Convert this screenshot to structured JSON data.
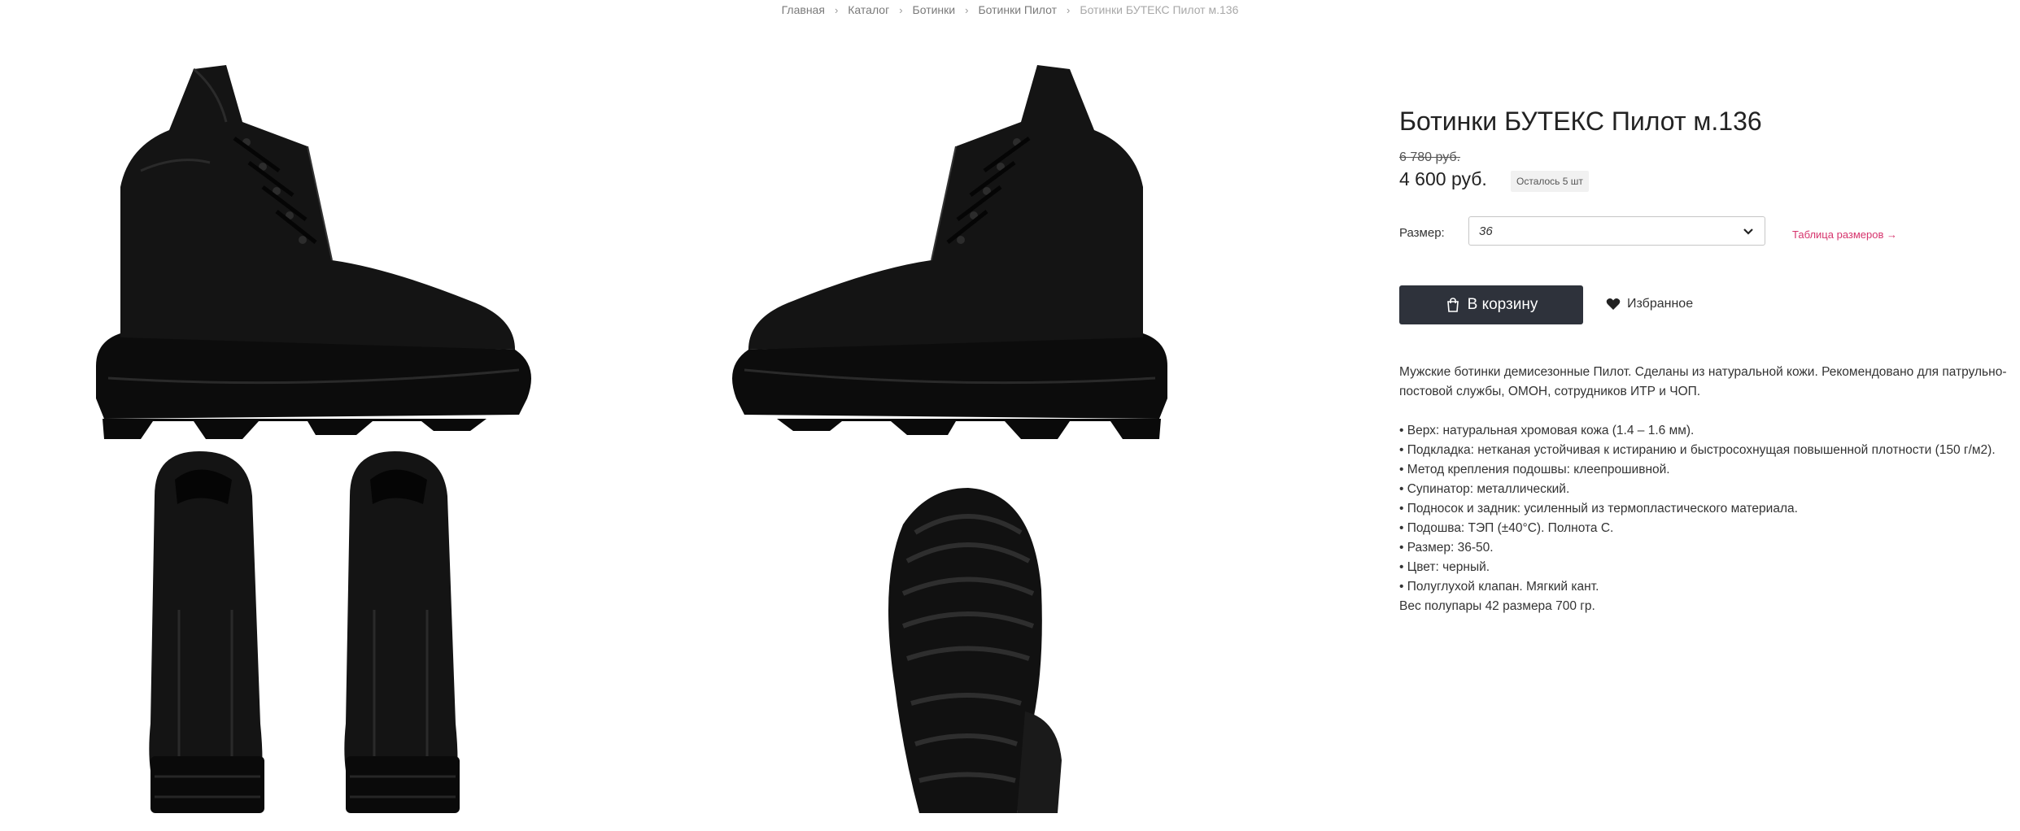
{
  "breadcrumb": {
    "items": [
      "Главная",
      "Каталог",
      "Ботинки",
      "Ботинки Пилот"
    ],
    "current": "Ботинки БУТЕКС Пилот м.136",
    "separator": "›"
  },
  "product": {
    "title": "Ботинки БУТЕКС Пилот м.136",
    "old_price": "6 780 руб.",
    "price": "4 600 руб.",
    "stock_badge": "Осталось 5 шт",
    "size_label": "Размер:",
    "size_value": "36",
    "size_table_link": "Таблица размеров →",
    "cart_button": "В корзину",
    "favorite_label": "Избранное",
    "description_intro": "Мужские ботинки демисезонные Пилот. Сделаны из натуральной кожи. Рекомендовано для патрульно-постовой службы, ОМОН, сотрудников ИТР и ЧОП.",
    "features": [
      "• Верх: натуральная хромовая кожа (1.4 – 1.6 мм).",
      "• Подкладка: нетканая устойчивая к истиранию и быстросохнущая повышенной плотности (150 г/м2).",
      "• Метод крепления подошвы: клеепрошивной.",
      "• Супинатор: металлический.",
      "• Подносок и задник: усиленный из термопластического материала.",
      "• Подошва: ТЭП (±40°С). Полнота С.",
      "• Размер: 36-50.",
      "• Цвет: черный.",
      "• Полуглухой клапан. Мягкий кант."
    ],
    "weight_note": "Вес полупары 42 размера 700 гр."
  },
  "colors": {
    "button_bg": "#2e323b",
    "link_accent": "#d6336c",
    "boot": "#111111"
  },
  "icons": {
    "breadcrumb_separator": "chevron-right-icon",
    "select_arrow": "chevron-down-icon",
    "cart": "shopping-bag-icon",
    "favorite": "heart-icon"
  }
}
